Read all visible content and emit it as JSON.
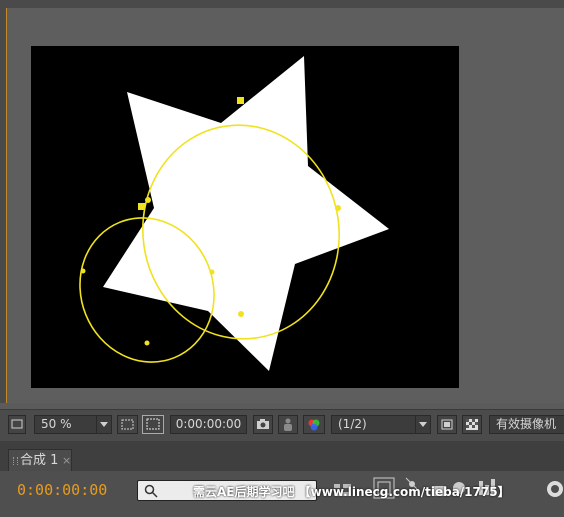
{
  "viewer": {
    "zoom": "50 %",
    "timecode": "0:00:00:00",
    "resolution": "(1/2)",
    "camera": "有效摄像机"
  },
  "panel": {
    "tab_label": "合成 1",
    "tab_close": "×"
  },
  "timeline": {
    "current_time": "0:00:00:00"
  },
  "watermark": {
    "text": "需云AE后期学习吧 【www.linecg.com/tieba/1775】"
  },
  "colors": {
    "mask_path": "#f0e21e",
    "timecode": "#e59c1f",
    "shape": "#ffffff"
  }
}
